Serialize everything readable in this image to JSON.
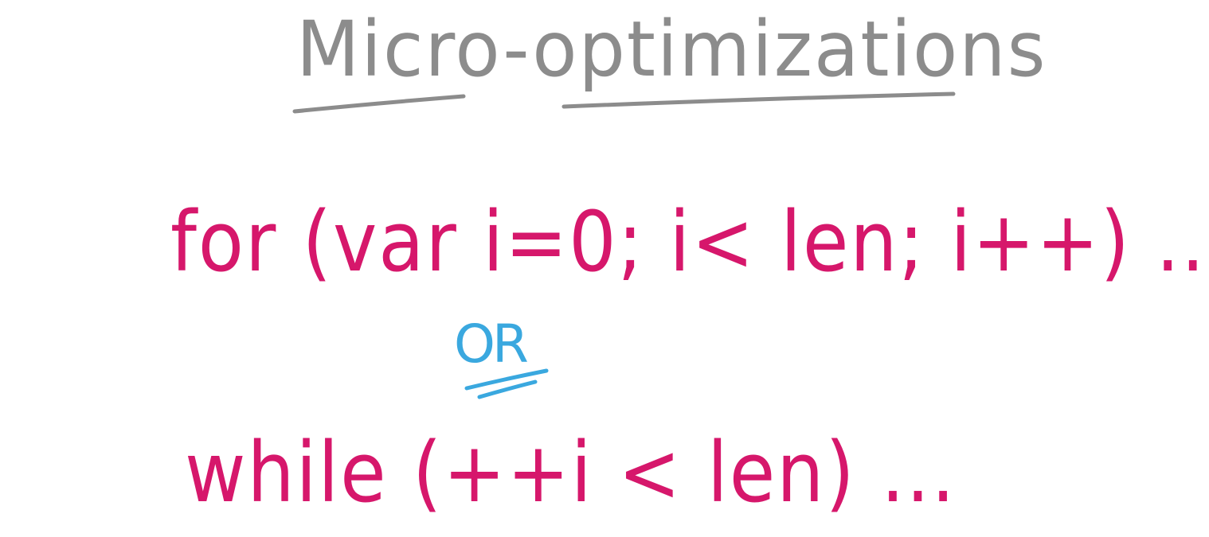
{
  "title": "Micro-optimizations",
  "code_option_one": "for (var i=0; i< len; i++) ...",
  "separator": "OR",
  "code_option_two": "while (++i < len) ...",
  "colors": {
    "title_ink": "#8c8c8c",
    "code_ink": "#d6176b",
    "separator_ink": "#3aa8df",
    "background": "#ffffff"
  }
}
